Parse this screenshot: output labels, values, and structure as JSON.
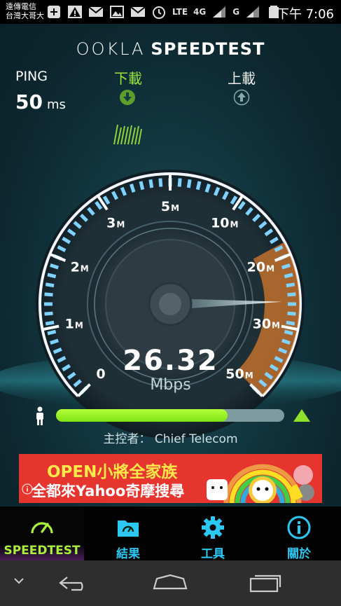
{
  "status_bar": {
    "carrier_line1": "遠傳電信",
    "carrier_line2": "台灣大哥大",
    "icons": [
      "add-icon",
      "warning-icon",
      "mail-icon",
      "image-icon",
      "mail-icon",
      "alarm-icon",
      "lte-signal-icon",
      "4g-signal-icon",
      "3g-signal-icon",
      "battery-icon"
    ],
    "lte_text": "LTE",
    "fourg_text": "4G",
    "threeg_text": "G",
    "time": "下午 7:06"
  },
  "app": {
    "brand_ookla": "OOKLA",
    "brand_speedtest": "SPEEDTEST",
    "ping": {
      "label": "PING",
      "value": "50",
      "unit": "ms"
    },
    "download": {
      "label": "下載",
      "icon": "download-arrow-icon"
    },
    "upload": {
      "label": "上載",
      "icon": "upload-arrow-icon"
    },
    "gauge": {
      "ticks": [
        {
          "num": "0",
          "unit": ""
        },
        {
          "num": "1",
          "unit": "M"
        },
        {
          "num": "2",
          "unit": "M"
        },
        {
          "num": "3",
          "unit": "M"
        },
        {
          "num": "5",
          "unit": "M"
        },
        {
          "num": "10",
          "unit": "M"
        },
        {
          "num": "20",
          "unit": "M"
        },
        {
          "num": "30",
          "unit": "M"
        },
        {
          "num": "50",
          "unit": "M"
        }
      ],
      "value_mbps": 26.32
    },
    "speed_value": "26.32",
    "speed_unit": "Mbps",
    "progress_fraction": 0.75,
    "host_label": "主控者：",
    "host_name": "Chief Telecom",
    "ad": {
      "line1": "OPEN小將全家族",
      "line2": "全都來Yahoo奇摩搜尋",
      "icon": "info-icon"
    }
  },
  "tabs": [
    {
      "label": "SPEEDTEST",
      "icon": "gauge-icon"
    },
    {
      "label": "結果",
      "icon": "folder-icon"
    },
    {
      "label": "工具",
      "icon": "gear-icon"
    },
    {
      "label": "關於",
      "icon": "info-icon"
    }
  ],
  "colors": {
    "accent_green": "#9be43b",
    "accent_cyan": "#2cc8f2",
    "gauge_orange": "#d77a2e"
  }
}
